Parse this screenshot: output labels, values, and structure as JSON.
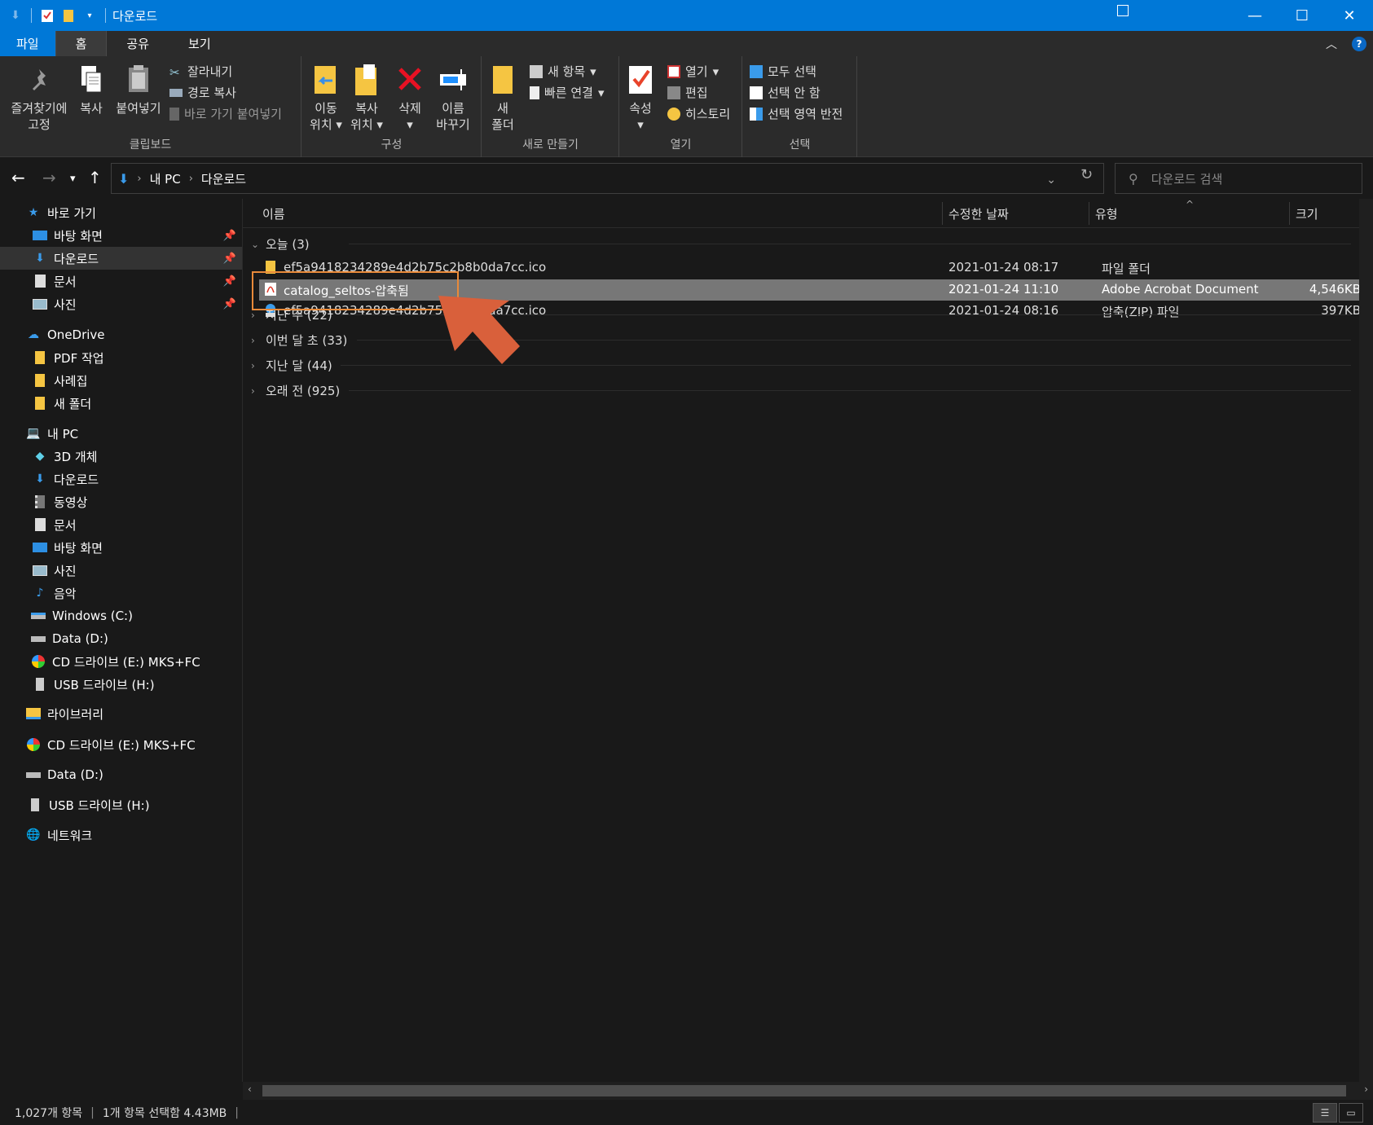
{
  "window": {
    "title": "다운로드",
    "accent": "#0078d7"
  },
  "ribbon_tabs": {
    "file": "파일",
    "home": "홈",
    "share": "공유",
    "view": "보기"
  },
  "ribbon": {
    "clipboard": {
      "label": "클립보드",
      "pin": "즐겨찾기에",
      "pin2": "고정",
      "copy": "복사",
      "paste": "붙여넣기",
      "cut": "잘라내기",
      "copy_path": "경로 복사",
      "paste_shortcut": "바로 가기 붙여넣기"
    },
    "organize": {
      "label": "구성",
      "move1": "이동",
      "move2": "위치",
      "copyto1": "복사",
      "copyto2": "위치",
      "delete": "삭제",
      "rename1": "이름",
      "rename2": "바꾸기"
    },
    "new": {
      "label": "새로 만들기",
      "folder1": "새",
      "folder2": "폴더",
      "new_item": "새 항목",
      "easy_access": "빠른 연결"
    },
    "open": {
      "label": "열기",
      "properties": "속성",
      "open": "열기",
      "edit": "편집",
      "history": "히스토리"
    },
    "select": {
      "label": "선택",
      "select_all": "모두 선택",
      "select_none": "선택 안 함",
      "invert": "선택 영역 반전"
    }
  },
  "address": {
    "crumbs": [
      "내 PC",
      "다운로드"
    ],
    "search_placeholder": "다운로드 검색"
  },
  "nav": {
    "quick_access": "바로 가기",
    "qa_items": [
      "바탕 화면",
      "다운로드",
      "문서",
      "사진"
    ],
    "onedrive": "OneDrive",
    "onedrive_items": [
      "PDF 작업",
      "사례집",
      "새 폴더"
    ],
    "this_pc": "내 PC",
    "pc_items": [
      "3D 개체",
      "다운로드",
      "동영상",
      "문서",
      "바탕 화면",
      "사진",
      "음악",
      "Windows (C:)",
      "Data (D:)",
      "CD 드라이브 (E:) MKS+FC",
      "USB 드라이브 (H:)"
    ],
    "libraries": "라이브러리",
    "cd_drive": "CD 드라이브 (E:) MKS+FC",
    "data_drive": "Data (D:)",
    "usb_drive": "USB 드라이브 (H:)",
    "network": "네트워크"
  },
  "columns": {
    "name": "이름",
    "modified": "수정한 날짜",
    "type": "유형",
    "size": "크기"
  },
  "groups": {
    "today": "오늘 (3)",
    "last_week": "지난 주 (22)",
    "earlier_month": "이번 달 초 (33)",
    "last_month": "지난 달 (44)",
    "long_ago": "오래 전 (925)"
  },
  "files": [
    {
      "name": "ef5a9418234289e4d2b75c2b8b0da7cc.ico",
      "modified": "2021-01-24 08:17",
      "type": "파일 폴더",
      "size": "",
      "icon": "folder-icon"
    },
    {
      "name": "catalog_seltos-압축됨",
      "modified": "2021-01-24 11:10",
      "type": "Adobe Acrobat Document",
      "size": "4,546KB",
      "icon": "pdf-icon",
      "selected": true
    },
    {
      "name": "ef5a9418234289e4d2b75c2b8b0da7cc.ico",
      "modified": "2021-01-24 08:16",
      "type": "압축(ZIP) 파일",
      "size": "397KB",
      "icon": "zip-icon"
    }
  ],
  "status": {
    "count": "1,027개 항목",
    "selection": "1개 항목 선택함 4.43MB"
  },
  "annotation": {
    "box_color": "#e88a3a",
    "arrow_color": "#d9603b"
  }
}
